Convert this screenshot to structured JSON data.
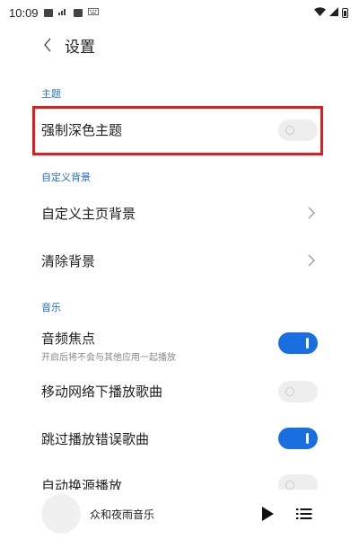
{
  "status_bar": {
    "time": "10:09"
  },
  "header": {
    "title": "设置"
  },
  "sections": {
    "theme": {
      "label": "主题",
      "items": [
        {
          "label": "强制深色主题",
          "toggle": "off"
        }
      ]
    },
    "background": {
      "label": "自定义背景",
      "items": [
        {
          "label": "自定义主页背景"
        },
        {
          "label": "清除背景"
        }
      ]
    },
    "music": {
      "label": "音乐",
      "items": [
        {
          "label": "音频焦点",
          "sublabel": "开启后将不会与其他应用一起播放",
          "toggle": "on"
        },
        {
          "label": "移动网络下播放歌曲",
          "toggle": "off"
        },
        {
          "label": "跳过播放错误歌曲",
          "toggle": "on"
        },
        {
          "label": "自动换源播放",
          "toggle": "off"
        }
      ]
    }
  },
  "player": {
    "song": "众和夜雨音乐",
    "play_icon": "play-icon",
    "list_icon": "playlist-icon"
  },
  "colors": {
    "accent": "#1a6fe0",
    "highlight": "#e01e1e",
    "section_label": "#1f6fd6"
  }
}
